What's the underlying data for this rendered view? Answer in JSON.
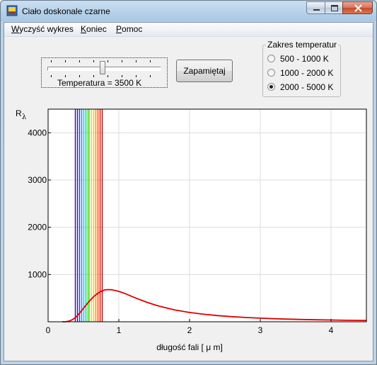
{
  "window": {
    "title": "Ciało doskonale czarne"
  },
  "menu": [
    {
      "label": "Wyczyść wykres"
    },
    {
      "label": "Koniec"
    },
    {
      "label": "Pomoc"
    }
  ],
  "slider": {
    "label": "Temperatura =  3500 K",
    "value_k": 3500,
    "min_k": 2000,
    "max_k": 5000
  },
  "save_button": "Zapamiętaj",
  "range_group": {
    "title": "Zakres temperatur",
    "options": [
      {
        "label": "500 - 1000 K",
        "selected": false
      },
      {
        "label": "1000 - 2000 K",
        "selected": false
      },
      {
        "label": "2000 - 5000 K",
        "selected": true
      }
    ]
  },
  "chart_data": {
    "type": "line",
    "ylabel": "R",
    "ylabel_sub": "λ",
    "xlabel": "długość fali [ μ m]",
    "xlim": [
      0,
      4.5
    ],
    "ylim": [
      0,
      4500
    ],
    "x_ticks": [
      0,
      1,
      2,
      3,
      4
    ],
    "y_ticks": [
      1000,
      2000,
      3000,
      4000
    ],
    "grid": true,
    "visible_band_um": [
      0.38,
      0.76
    ],
    "visible_band_colors": [
      "#4b00b4",
      "#3000ff",
      "#0040ff",
      "#0090ff",
      "#00c8e0",
      "#00d070",
      "#30d000",
      "#90e000",
      "#e0e000",
      "#ffc000",
      "#ff8000",
      "#ff4000",
      "#e00000",
      "#b00000"
    ],
    "series": [
      {
        "color": "#e00000",
        "x": [
          0.2,
          0.25,
          0.3,
          0.35,
          0.4,
          0.45,
          0.5,
          0.55,
          0.6,
          0.65,
          0.7,
          0.75,
          0.8,
          0.83,
          0.9,
          1.0,
          1.1,
          1.2,
          1.3,
          1.4,
          1.5,
          1.6,
          1.8,
          2.0,
          2.2,
          2.4,
          2.6,
          2.8,
          3.0,
          3.2,
          3.4,
          3.6,
          3.8,
          4.0,
          4.2,
          4.5
        ],
        "y": [
          0,
          2,
          15,
          49,
          110,
          191,
          284,
          378,
          465,
          540,
          600,
          645,
          674,
          681,
          678,
          644,
          589,
          527,
          466,
          411,
          361,
          318,
          248,
          197,
          159,
          130,
          108,
          90,
          76,
          65,
          56,
          48,
          42,
          37,
          32,
          27
        ]
      }
    ]
  }
}
